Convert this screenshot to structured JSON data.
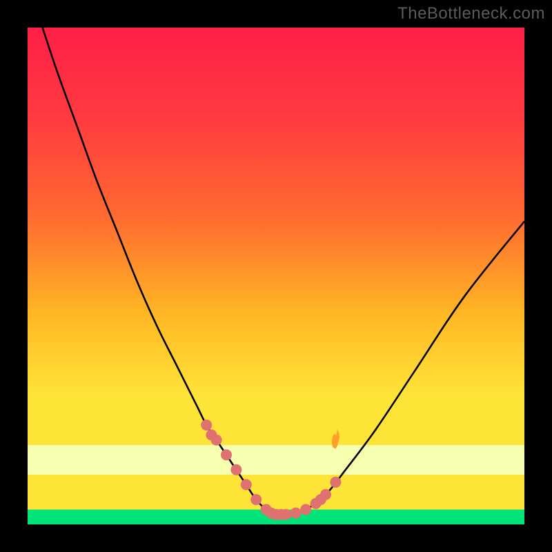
{
  "watermark": "TheBottleneck.com",
  "colors": {
    "frame": "#000000",
    "yellow": "#ffe438",
    "limeBand": "#f6ffb0",
    "green": "#00e47a",
    "redTop": "#ff1f47",
    "redMid": "#ff4a3a",
    "orange": "#ff7a2d",
    "curve": "#000000",
    "marker": "#e07171",
    "flame": "#ffa029"
  },
  "chart_data": {
    "type": "line",
    "title": "",
    "xlabel": "",
    "ylabel": "",
    "xlim": [
      0,
      100
    ],
    "ylim": [
      0,
      100
    ],
    "grid": false,
    "legend": false,
    "annotations": [],
    "series": [
      {
        "name": "curve",
        "x": [
          3,
          6,
          10,
          14,
          18,
          22,
          26,
          30,
          34,
          36,
          38,
          40,
          42,
          44,
          46,
          48,
          50,
          52,
          56,
          60,
          64,
          70,
          78,
          88,
          100
        ],
        "y": [
          100,
          91,
          80,
          69,
          59,
          49,
          40,
          32,
          24,
          20,
          17,
          14,
          11,
          8,
          5,
          3,
          2,
          2,
          3,
          6,
          11,
          19,
          31,
          46,
          61
        ]
      }
    ],
    "markers": {
      "name": "highlight-points",
      "x": [
        36,
        37,
        38,
        40,
        42,
        44,
        46,
        48,
        49,
        50,
        51,
        52,
        54,
        56,
        58,
        59,
        60,
        62
      ],
      "y": [
        20,
        18,
        17,
        14,
        11,
        8,
        5,
        3,
        2.3,
        2,
        2,
        2,
        2.3,
        3,
        4.2,
        5,
        6,
        8.5
      ]
    }
  }
}
